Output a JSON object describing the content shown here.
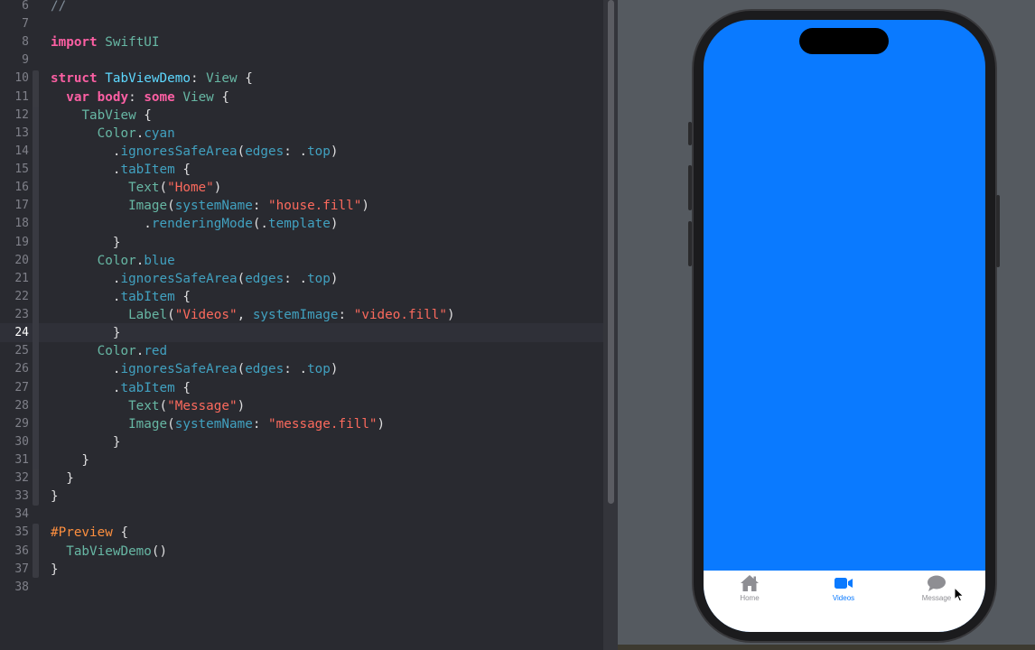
{
  "editor": {
    "current_line": 24,
    "lines": [
      {
        "n": "6",
        "t": "//"
      },
      {
        "n": "7",
        "t": ""
      },
      {
        "n": "8",
        "t": "import SwiftUI"
      },
      {
        "n": "9",
        "t": ""
      },
      {
        "n": "10",
        "t": "struct TabViewDemo: View {"
      },
      {
        "n": "11",
        "t": "  var body: some View {"
      },
      {
        "n": "12",
        "t": "    TabView {"
      },
      {
        "n": "13",
        "t": "      Color.cyan"
      },
      {
        "n": "14",
        "t": "        .ignoresSafeArea(edges: .top)"
      },
      {
        "n": "15",
        "t": "        .tabItem {"
      },
      {
        "n": "16",
        "t": "          Text(\"Home\")"
      },
      {
        "n": "17",
        "t": "          Image(systemName: \"house.fill\")"
      },
      {
        "n": "18",
        "t": "            .renderingMode(.template)"
      },
      {
        "n": "19",
        "t": "        }"
      },
      {
        "n": "20",
        "t": "      Color.blue"
      },
      {
        "n": "21",
        "t": "        .ignoresSafeArea(edges: .top)"
      },
      {
        "n": "22",
        "t": "        .tabItem {"
      },
      {
        "n": "23",
        "t": "          Label(\"Videos\", systemImage: \"video.fill\")"
      },
      {
        "n": "24",
        "t": "        }"
      },
      {
        "n": "25",
        "t": "      Color.red"
      },
      {
        "n": "26",
        "t": "        .ignoresSafeArea(edges: .top)"
      },
      {
        "n": "27",
        "t": "        .tabItem {"
      },
      {
        "n": "28",
        "t": "          Text(\"Message\")"
      },
      {
        "n": "29",
        "t": "          Image(systemName: \"message.fill\")"
      },
      {
        "n": "30",
        "t": "        }"
      },
      {
        "n": "31",
        "t": "    }"
      },
      {
        "n": "32",
        "t": "  }"
      },
      {
        "n": "33",
        "t": "}"
      },
      {
        "n": "34",
        "t": ""
      },
      {
        "n": "35",
        "t": "#Preview {"
      },
      {
        "n": "36",
        "t": "  TabViewDemo()"
      },
      {
        "n": "37",
        "t": "}"
      },
      {
        "n": "38",
        "t": ""
      }
    ]
  },
  "preview": {
    "screen_color": "#0a7aff",
    "tabs": [
      {
        "label": "Home",
        "icon": "house-fill-icon",
        "selected": false
      },
      {
        "label": "Videos",
        "icon": "video-fill-icon",
        "selected": true
      },
      {
        "label": "Message",
        "icon": "message-fill-icon",
        "selected": false
      }
    ]
  },
  "colors": {
    "keyword": "#fc5fa3",
    "type": "#5dd8ff",
    "function": "#67b7a4",
    "string": "#fc6a5d",
    "comment": "#7f8c98",
    "accent": "#0a7aff"
  }
}
